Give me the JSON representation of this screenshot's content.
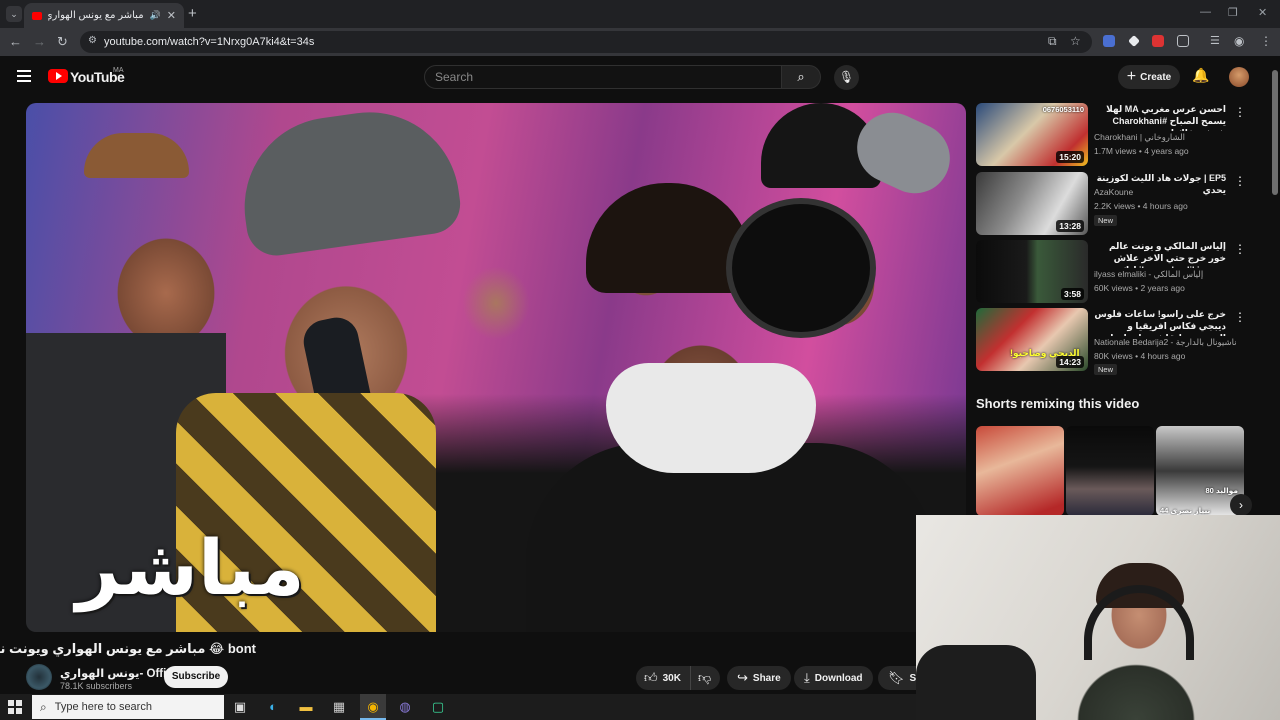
{
  "browser": {
    "tab_title": "مباشر مع يونس الهواري ويونت",
    "url": "youtube.com/watch?v=1Nrxg0A7ki4&t=34s"
  },
  "yt_header": {
    "brand": "YouTube",
    "region": "MA",
    "search_placeholder": "Search",
    "create_label": "Create"
  },
  "video": {
    "overlay_text": "مباشر",
    "title": "bont 😂 مباشر مع يونس الهواري ويونت نشاط",
    "channel_name": "يونس الهواري- Officiel",
    "subscribers": "78.1K subscribers",
    "subscribe_label": "Subscribe",
    "likes": "30K",
    "share_label": "Share",
    "download_label": "Download",
    "save_label": "Sa"
  },
  "recommendations": [
    {
      "title": "احسن عرس مغربي MA لهلا يسمح الصباح #Charokhani شوفي فاك اوزونو ...",
      "channel": "Charokhani | الشاروخاني",
      "meta": "1.7M views • 4 years ago",
      "duration": "15:20",
      "new": "",
      "thumb_text": "0676053110"
    },
    {
      "title": "EP5 | جولات هاد الليث لكوزينة يحدي",
      "channel": "AzaKoune",
      "meta": "2.2K views • 4 hours ago",
      "duration": "13:28",
      "new": "New",
      "thumb_text": ""
    },
    {
      "title": "إلياس المالكي و يونت عالم خور خرج حتي الاخر علاش يهرب ilyass elmaliki ليك",
      "channel": "ilyass elmaliki - إلياس المالكي",
      "meta": "60K views • 2 years ago",
      "duration": "3:58",
      "new": "",
      "thumb_text": ""
    },
    {
      "title": "خرج على راسو! ساعات فلوس ديبجي فكاس افريقيا و الجمهور مايقاش ساخط على ...",
      "channel": "Nationale Bedarija2 - ناشيونال بالدارجة",
      "meta": "80K views • 4 hours ago",
      "duration": "14:23",
      "new": "New",
      "thumb_text": "الديجي وصاحبو!"
    }
  ],
  "shorts": {
    "heading": "Shorts remixing this video",
    "items": [
      {
        "label": ""
      },
      {
        "label": ""
      },
      {
        "label": "موالبد 80",
        "label2": "نبيار نصرى 44"
      }
    ]
  },
  "taskbar": {
    "search_placeholder": "Type here to search"
  },
  "colors": {
    "yt_red": "#ff0000",
    "background": "#0f0f0f",
    "pill": "#272727"
  }
}
